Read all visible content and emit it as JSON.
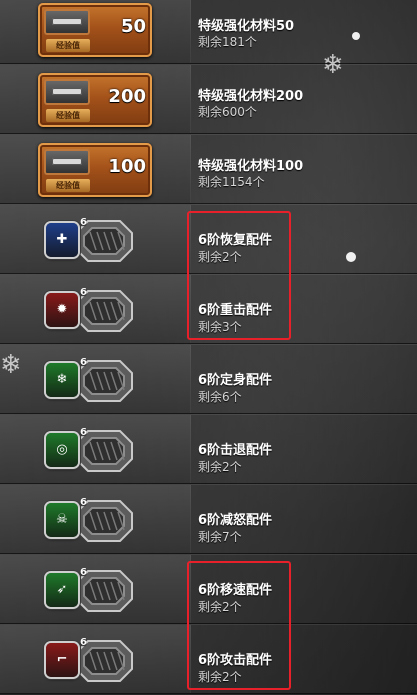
{
  "remaining_label": "剩余",
  "remaining_unit": "个",
  "exp_tag": "经验值",
  "level_mark": "6",
  "exp_items": [
    {
      "name": "特级强化材料50",
      "amount": "50",
      "remaining": "181"
    },
    {
      "name": "特级强化材料200",
      "amount": "200",
      "remaining": "600"
    },
    {
      "name": "特级强化材料100",
      "amount": "100",
      "remaining": "1154"
    }
  ],
  "parts": [
    {
      "name": "6阶恢复配件",
      "remaining": "2",
      "badge_color": "#1f3f8a",
      "icon": "heal-glyph-icon",
      "symbol": "✚",
      "highlighted": true
    },
    {
      "name": "6阶重击配件",
      "remaining": "3",
      "badge_color": "#8a1a1a",
      "icon": "burst-glyph-icon",
      "symbol": "✹",
      "highlighted": true
    },
    {
      "name": "6阶定身配件",
      "remaining": "6",
      "badge_color": "#1f7a2a",
      "icon": "freeze-glyph-icon",
      "symbol": "❄",
      "highlighted": false
    },
    {
      "name": "6阶击退配件",
      "remaining": "2",
      "badge_color": "#1f7a2a",
      "icon": "knockback-glyph-icon",
      "symbol": "◎",
      "highlighted": false
    },
    {
      "name": "6阶减怒配件",
      "remaining": "7",
      "badge_color": "#1f7a2a",
      "icon": "skull-glyph-icon",
      "symbol": "☠",
      "highlighted": false
    },
    {
      "name": "6阶移速配件",
      "remaining": "2",
      "badge_color": "#1f7a2a",
      "icon": "boot-glyph-icon",
      "symbol": "➶",
      "highlighted": true
    },
    {
      "name": "6阶攻击配件",
      "remaining": "2",
      "badge_color": "#8a1a1a",
      "icon": "gun-glyph-icon",
      "symbol": "⌐",
      "highlighted": true
    }
  ]
}
